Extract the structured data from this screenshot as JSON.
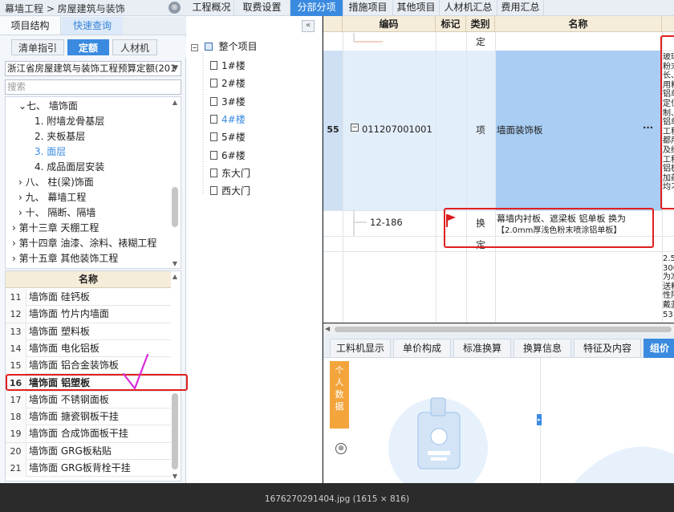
{
  "left_panel": {
    "breadcrumb": "幕墙工程 > 房屋建筑与装饰",
    "tab_structure": "项目结构",
    "tab_quick": "快速查询",
    "tab_list": "清单指引",
    "tab_quota": "定额",
    "tab_material": "人材机",
    "quota_db": "浙江省房屋建筑与装饰工程预算定额(201",
    "search_placeholder": "搜索",
    "tree": [
      {
        "label": "⌄七、 墙饰面",
        "level": 1
      },
      {
        "label": "1.  附墙龙骨基层",
        "level": 2
      },
      {
        "label": "2.  夹板基层",
        "level": 2
      },
      {
        "label": "3.  面层",
        "level": 2,
        "selected": true
      },
      {
        "label": "4.  成品面层安装",
        "level": 2
      },
      {
        "label": "›  八、 柱(梁)饰面",
        "level": 1
      },
      {
        "label": "›  九、 幕墙工程",
        "level": 1
      },
      {
        "label": "›  十、 隔断、隔墙",
        "level": 1
      },
      {
        "label": "› 第十三章  天棚工程",
        "level": 0
      },
      {
        "label": "› 第十四章  油漆、涂料、裱糊工程",
        "level": 0
      },
      {
        "label": "› 第十五章  其他装饰工程",
        "level": 0
      }
    ],
    "list_header": "名称",
    "list": [
      {
        "num": "11",
        "name": "墙饰面 硅钙板"
      },
      {
        "num": "12",
        "name": "墙饰面 竹片内墙面"
      },
      {
        "num": "13",
        "name": "墙饰面 塑料板"
      },
      {
        "num": "14",
        "name": "墙饰面 电化铝板"
      },
      {
        "num": "15",
        "name": "墙饰面 铝合金装饰板"
      },
      {
        "num": "16",
        "name": "墙饰面 铝塑板",
        "highlight": true
      },
      {
        "num": "17",
        "name": "墙饰面 不锈钢面板"
      },
      {
        "num": "18",
        "name": "墙饰面 搪瓷钢板干挂"
      },
      {
        "num": "19",
        "name": "墙饰面 合成饰面板干挂"
      },
      {
        "num": "20",
        "name": "墙饰面 GRG板粘贴"
      },
      {
        "num": "21",
        "name": "墙饰面 GRG板背栓干挂"
      }
    ]
  },
  "middle_tree": {
    "collapse_btn": "«",
    "root": "整个项目",
    "items": [
      "1#楼",
      "2#楼",
      "3#楼",
      "4#楼",
      "5#楼",
      "6#楼",
      "东大门",
      "西大门"
    ],
    "active_index": 3
  },
  "top_tabs": [
    "工程概况",
    "取费设置",
    "分部分项",
    "措施项目",
    "其他项目",
    "人材机汇总",
    "费用汇总"
  ],
  "top_tabs_active": 2,
  "grid": {
    "headers": [
      "编码",
      "标记",
      "类别",
      "名称"
    ],
    "row_top_type": "定",
    "row_main": {
      "num": "55",
      "code": "011207001001",
      "type": "项",
      "name": "墙面装饰板",
      "more": "···"
    },
    "row_sub": {
      "code": "12-186",
      "type": "换",
      "name_line1": "幕墙内衬板、遮梁板 铝单板  换为",
      "name_line2": "【2.0mm厚浅色粉末喷涂铝单板】"
    },
    "row_after_type": "定",
    "side_text_top": "玻璃\n粉末\n长、\n用料\n铝单\n定位\n制、\n铝单\n工程\n都用\n及经\n工程\n铝板\n加药\n均刁",
    "side_text_bottom": "2.5\n300\n为准\n送料\n性隔\n戴蓝\n53"
  },
  "bottom_tabs": [
    "工料机显示",
    "单价构成",
    "标准换算",
    "换算信息",
    "特征及内容",
    "组价"
  ],
  "bottom_tabs_active": 5,
  "personal_label": "个人数据",
  "globe": "⊕",
  "viewer_caption": "1676270291404.jpg (1615 × 816)",
  "colors": {
    "accent": "#3a8be0",
    "annotation": "#e02020",
    "header_bg": "#f5ecd9",
    "personal": "#f3a53b"
  }
}
